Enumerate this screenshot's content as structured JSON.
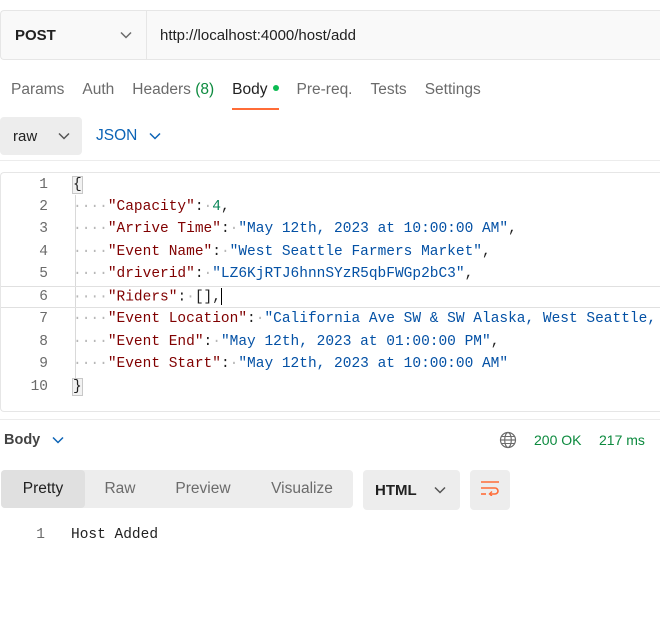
{
  "request": {
    "method": "POST",
    "url": "http://localhost:4000/host/add"
  },
  "tabs": [
    {
      "label": "Params"
    },
    {
      "label": "Auth"
    },
    {
      "label": "Headers",
      "count": "(8)"
    },
    {
      "label": "Body",
      "active": true
    },
    {
      "label": "Pre-req."
    },
    {
      "label": "Tests"
    },
    {
      "label": "Settings"
    }
  ],
  "body_mode": {
    "type": "raw",
    "language": "JSON"
  },
  "editor": {
    "line_numbers": [
      "1",
      "2",
      "3",
      "4",
      "5",
      "6",
      "7",
      "8",
      "9",
      "10"
    ],
    "lines": [
      {
        "brace": "{"
      },
      {
        "key": "\"Capacity\"",
        "num": "4",
        "tail": ","
      },
      {
        "key": "\"Arrive Time\"",
        "str": "\"May 12th, 2023 at 10:00:00 AM\"",
        "tail": ","
      },
      {
        "key": "\"Event Name\"",
        "str": "\"West Seattle Farmers Market\"",
        "tail": ","
      },
      {
        "key": "\"driverid\"",
        "str": "\"LZ6KjRTJ6hnnSYzR5qbFWGp2bC3\"",
        "tail": ","
      },
      {
        "key": "\"Riders\"",
        "plain": "[]",
        "tail": ","
      },
      {
        "key": "\"Event Location\"",
        "str": "\"California Ave SW & SW Alaska, West Seattle, WA\"",
        "tail": ","
      },
      {
        "key": "\"Event End\"",
        "str": "\"May 12th, 2023 at 01:00:00 PM\"",
        "tail": ","
      },
      {
        "key": "\"Event Start\"",
        "str": "\"May 12th, 2023 at 10:00:00 AM\"",
        "tail": ""
      },
      {
        "brace": "}"
      }
    ]
  },
  "response": {
    "title": "Body",
    "status": "200 OK",
    "time": "217 ms",
    "view_tabs": [
      "Pretty",
      "Raw",
      "Preview",
      "Visualize"
    ],
    "active_view": "Pretty",
    "format": "HTML",
    "line_number": "1",
    "content": "Host Added"
  },
  "colors": {
    "accent": "#ff6c37",
    "success": "#0c8a3e",
    "link": "#0b63b6"
  },
  "icons": [
    "chevron-down-icon",
    "globe-icon",
    "wrap-lines-icon"
  ]
}
